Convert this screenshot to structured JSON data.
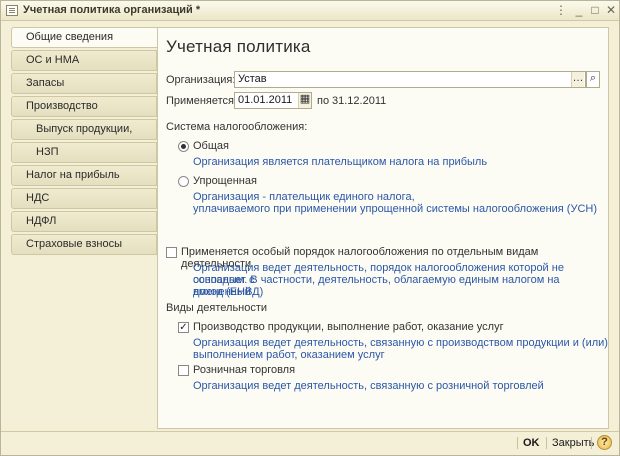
{
  "window": {
    "title": "Учетная политика организаций *"
  },
  "sidebar": {
    "items": [
      {
        "label": "Общие сведения"
      },
      {
        "label": "ОС и НМА"
      },
      {
        "label": "Запасы"
      },
      {
        "label": "Производство"
      },
      {
        "label": "Выпуск продукции, услуг"
      },
      {
        "label": "НЗП"
      },
      {
        "label": "Налог на прибыль"
      },
      {
        "label": "НДС"
      },
      {
        "label": "НДФЛ"
      },
      {
        "label": "Страховые взносы"
      }
    ]
  },
  "main": {
    "title": "Учетная политика",
    "org_label": "Организация:",
    "org_value": "Устав",
    "applies_label": "Применяется с:",
    "date_from": "01.01.2011",
    "to_label": "по",
    "date_to": "31.12.2011",
    "tax_system_label": "Система налогообложения:",
    "tax_general_label": "Общая",
    "tax_general_desc": "Организация является плательщиком налога на прибыль",
    "tax_simple_label": "Упрощенная",
    "tax_simple_desc_1": "Организация - плательщик единого налога,",
    "tax_simple_desc_2": "уплачиваемого при применении упрощенной системы налогообложения (УСН)",
    "special_label": "Применяется особый порядок налогообложения по отдельным видам деятельности",
    "special_desc_1": "Организация ведет деятельность, порядок налогообложения которой не совпадает с",
    "special_desc_2": "основным. В частности, деятельность, облагаемую единым налогом на вмененный",
    "special_desc_3": "доход (ЕНВД)",
    "activities_label": "Виды деятельности",
    "production_label": "Производство  продукции, выполнение работ, оказание услуг",
    "production_desc_1": "Организация ведет деятельность, связанную с производством продукции и (или)",
    "production_desc_2": "выполнением работ, оказанием услуг",
    "retail_label": "Розничная торговля",
    "retail_desc": "Организация ведет деятельность, связанную с розничной торговлей"
  },
  "footer": {
    "ok_label": "OK",
    "close_label": "Закрыть",
    "help_label": "?"
  }
}
